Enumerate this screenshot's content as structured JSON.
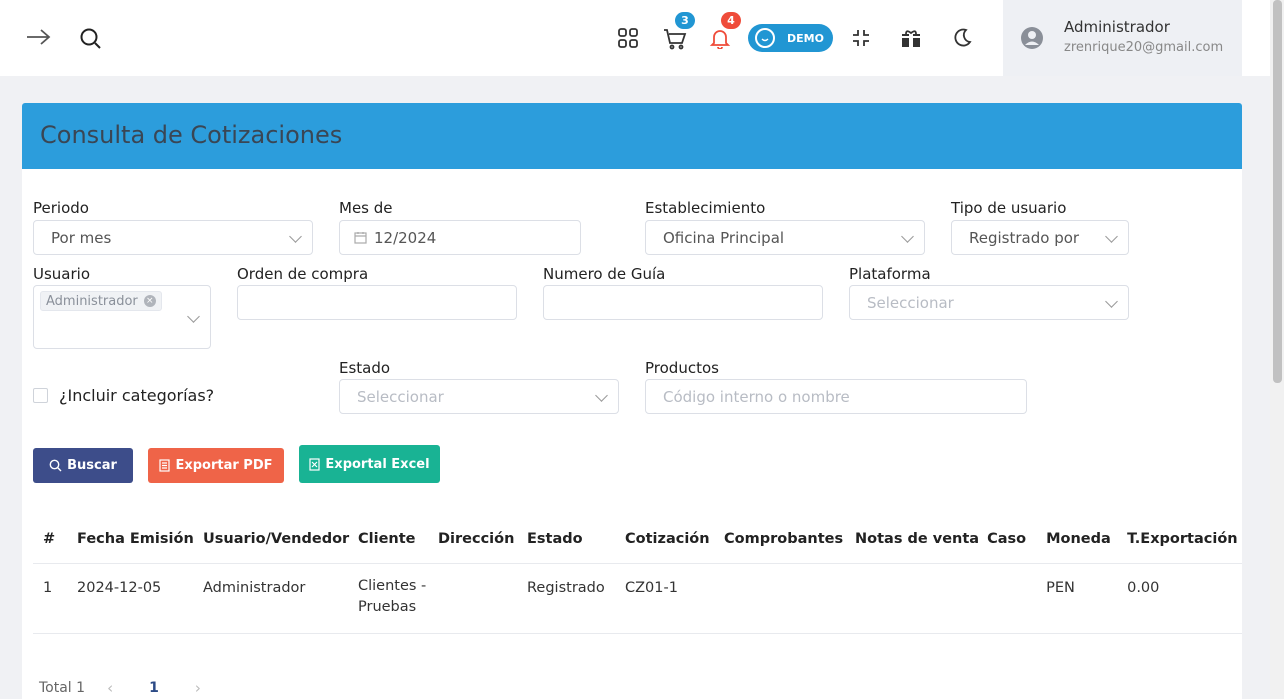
{
  "header": {
    "cart_count": "3",
    "notifications_count": "4",
    "demo_label": "DEMO",
    "user_name": "Administrador",
    "user_email": "zrenrique20@gmail.com"
  },
  "page": {
    "title": "Consulta de Cotizaciones"
  },
  "filters": {
    "periodo": {
      "label": "Periodo",
      "value": "Por mes"
    },
    "mes": {
      "label": "Mes de",
      "value": "12/2024"
    },
    "establecimiento": {
      "label": "Establecimiento",
      "value": "Oficina Principal"
    },
    "tipo_usuario": {
      "label": "Tipo de usuario",
      "value": "Registrado por"
    },
    "usuario": {
      "label": "Usuario",
      "tag": "Administrador"
    },
    "orden_compra": {
      "label": "Orden de compra",
      "value": ""
    },
    "numero_guia": {
      "label": "Numero de Guía",
      "value": ""
    },
    "plataforma": {
      "label": "Plataforma",
      "placeholder": "Seleccionar"
    },
    "incluir_categorias": {
      "label": "¿Incluir categorías?"
    },
    "estado": {
      "label": "Estado",
      "placeholder": "Seleccionar"
    },
    "productos": {
      "label": "Productos",
      "placeholder": "Código interno o nombre"
    }
  },
  "actions": {
    "buscar": "Buscar",
    "exportar_pdf": "Exportar PDF",
    "exportar_excel": "Exportal Excel"
  },
  "table": {
    "headers": [
      "#",
      "Fecha Emisión",
      "Usuario/Vendedor",
      "Cliente",
      "Dirección",
      "Estado",
      "Cotización",
      "Comprobantes",
      "Notas de venta",
      "Caso",
      "Moneda",
      "T.Exportación"
    ],
    "rows": [
      [
        "1",
        "2024-12-05",
        "Administrador",
        "Clientes - Pruebas",
        "",
        "Registrado",
        "CZ01-1",
        "",
        "",
        "",
        "PEN",
        "0.00"
      ]
    ]
  },
  "pagination": {
    "total": "Total 1",
    "current": "1"
  },
  "colors": {
    "accent_header": "#2c9ddc",
    "buscar": "#3d4d8a",
    "pdf": "#ef6448",
    "excel": "#19b394",
    "cart_badge": "#2196d3",
    "notif_badge": "#ef4c3a"
  }
}
